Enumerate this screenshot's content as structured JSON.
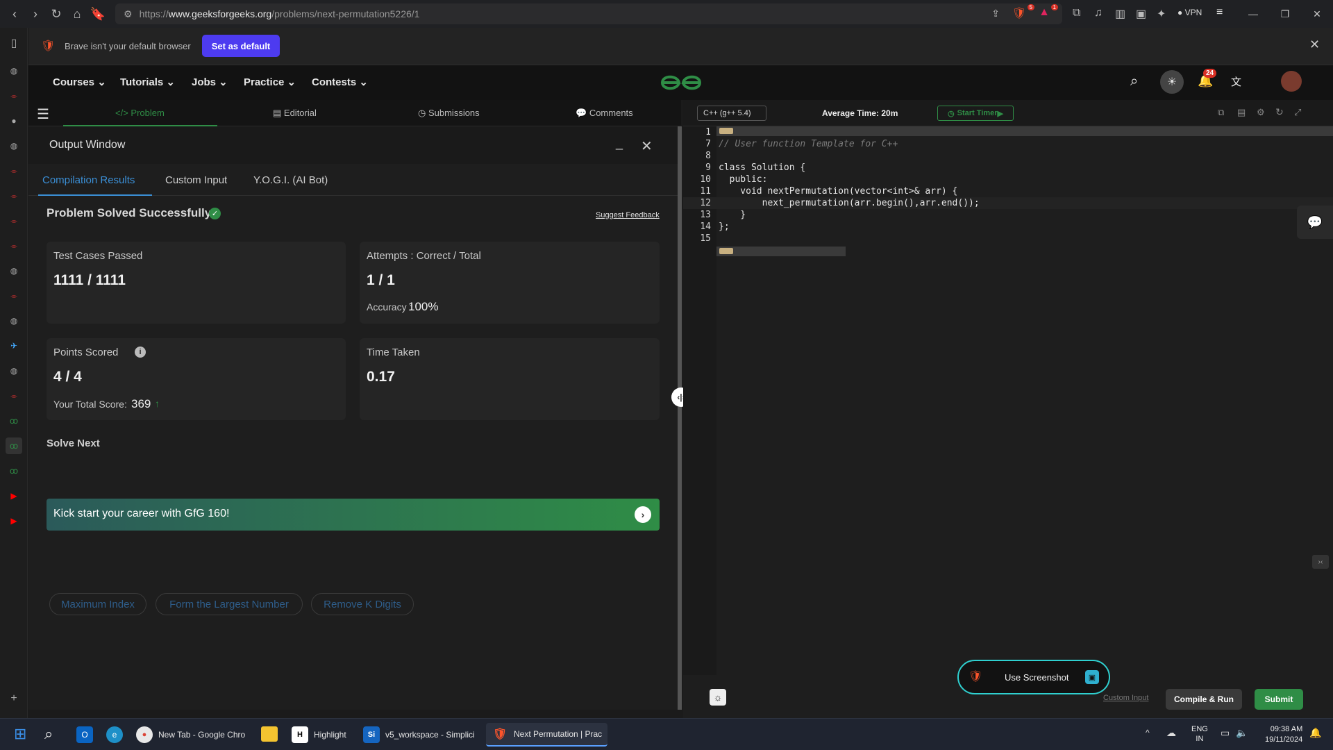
{
  "browser": {
    "url_prefix": "https://",
    "url_host": "www.geeksforgeeks.org",
    "url_path": "/problems/next-permutation5226/1",
    "vpn_label": "VPN",
    "brave_badge": "5",
    "alert_badge": "1"
  },
  "notification": {
    "message": "Brave isn't your default browser",
    "set_default_label": "Set as default"
  },
  "nav": {
    "items": [
      "Courses",
      "Tutorials",
      "Jobs",
      "Practice",
      "Contests"
    ],
    "logo": "GfG",
    "notification_count": "24"
  },
  "problem_tabs": {
    "problem": "Problem",
    "editorial": "Editorial",
    "submissions": "Submissions",
    "comments": "Comments"
  },
  "output": {
    "title": "Output Window",
    "tabs": [
      "Compilation Results",
      "Custom Input",
      "Y.O.G.I. (AI Bot)"
    ],
    "status": "Problem Solved Successfully",
    "suggest_feedback": "Suggest Feedback",
    "test_cases_label": "Test Cases Passed",
    "test_cases_value": "1111 / 1111",
    "attempts_label": "Attempts : Correct / Total",
    "attempts_value": "1 / 1",
    "accuracy_label": "Accuracy :",
    "accuracy_value": "100%",
    "points_label": "Points Scored",
    "points_value": "4 / 4",
    "total_score_label": "Your Total Score:",
    "total_score_value": "369",
    "time_label": "Time Taken",
    "time_value": "0.17",
    "solve_next_label": "Solve Next",
    "solve_next": [
      "Maximum Index",
      "Form the Largest Number",
      "Remove K Digits"
    ],
    "banner": "Kick start your career with GfG 160!"
  },
  "editor": {
    "language": "C++ (g++ 5.4)",
    "avg_time": "Average Time: 20m",
    "start_timer": "Start Timer",
    "lines": [
      {
        "n": "1",
        "text": ""
      },
      {
        "n": "7",
        "text": "// User function Template for C++"
      },
      {
        "n": "8",
        "text": ""
      },
      {
        "n": "9",
        "text": "class Solution {"
      },
      {
        "n": "10",
        "text": "  public:"
      },
      {
        "n": "11",
        "text": "    void nextPermutation(vector<int>& arr) {"
      },
      {
        "n": "12",
        "text": "        next_permutation(arr.begin(),arr.end());"
      },
      {
        "n": "13",
        "text": "    }"
      },
      {
        "n": "14",
        "text": "};"
      },
      {
        "n": "15",
        "text": ""
      }
    ],
    "use_screenshot": "Use Screenshot",
    "custom_input": "Custom Input",
    "compile_run": "Compile & Run",
    "submit": "Submit"
  },
  "taskbar": {
    "apps": [
      {
        "label": "New Tab - Google Chro"
      },
      {
        "label": "Highlight"
      },
      {
        "label": "v5_workspace - Simplici"
      },
      {
        "label": "Next Permutation | Prac"
      }
    ],
    "lang_line1": "ENG",
    "lang_line2": "IN",
    "time": "09:38 AM",
    "date": "19/11/2024"
  },
  "colors": {
    "accent_green": "#2f8d46",
    "link_blue": "#3b8fd6",
    "brave_button": "#4d3bf0"
  }
}
